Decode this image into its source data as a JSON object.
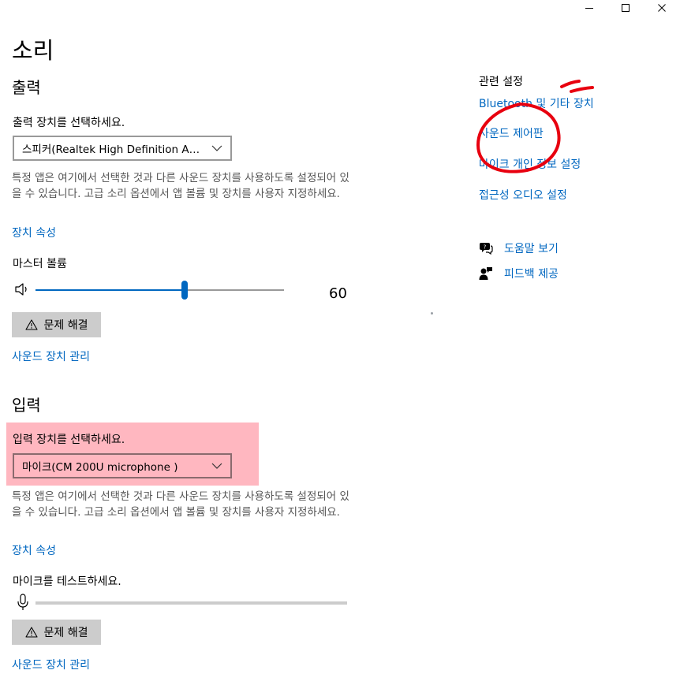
{
  "page_title": "소리",
  "window_controls": {
    "minimize": "minimize-icon",
    "maximize": "maximize-icon",
    "close": "close-icon"
  },
  "output": {
    "heading": "출력",
    "select_label": "출력 장치를 선택하세요.",
    "device": "스피커(Realtek High Definition Audio)",
    "description": "특정 앱은 여기에서 선택한 것과 다른 사운드 장치를 사용하도록 설정되어 있을 수 있습니다. 고급 소리 옵션에서 앱 볼륨 및 장치를 사용자 지정하세요.",
    "device_properties": "장치 속성",
    "master_volume_label": "마스터 볼륨",
    "volume": 60,
    "volume_text": "60",
    "troubleshoot": "문제 해결",
    "manage_devices": "사운드 장치 관리"
  },
  "input": {
    "heading": "입력",
    "select_label": "입력 장치를 선택하세요.",
    "device": "마이크(CM 200U microphone )",
    "description": "특정 앱은 여기에서 선택한 것과 다른 사운드 장치를 사용하도록 설정되어 있을 수 있습니다. 고급 소리 옵션에서 앱 볼륨 및 장치를 사용자 지정하세요.",
    "device_properties": "장치 속성",
    "test_label": "마이크를 테스트하세요.",
    "mic_level": 0,
    "troubleshoot": "문제 해결",
    "manage_devices": "사운드 장치 관리"
  },
  "related": {
    "title": "관련 설정",
    "links": [
      "Bluetooth 및 기타 장치",
      "사운드 제어판",
      "마이크 개인 정보 설정",
      "접근성 오디오 설정"
    ]
  },
  "help": {
    "get_help": "도움말 보기",
    "feedback": "피드백 제공"
  },
  "colors": {
    "accent": "#0067c0",
    "highlight": "#ffb7c0",
    "annotation": "#e8000f"
  }
}
